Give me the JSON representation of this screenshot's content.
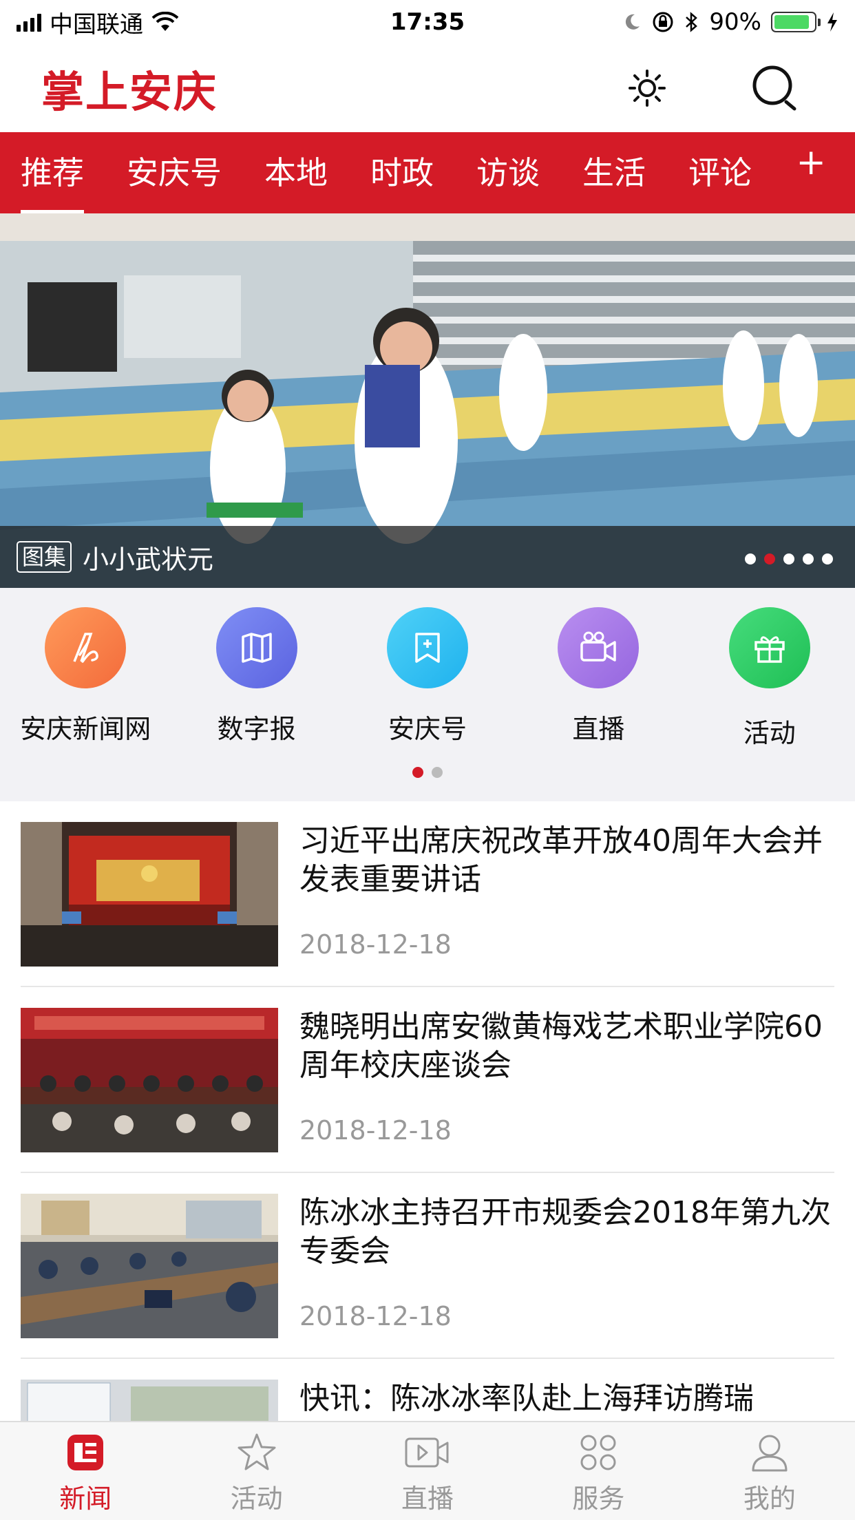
{
  "status_bar": {
    "carrier": "中国联通",
    "time": "17:35",
    "battery": "90%"
  },
  "header": {
    "logo": "掌上安庆",
    "icons": [
      "brightness-icon",
      "search-icon"
    ]
  },
  "channels": [
    "推荐",
    "安庆号",
    "本地",
    "时政",
    "访谈",
    "生活",
    "评论"
  ],
  "channel_more": "+",
  "banner": {
    "tag": "图集",
    "title": "小小武状元",
    "dots_count": 5,
    "active_dot": 2
  },
  "quick_nav": [
    {
      "label": "安庆新闻网",
      "icon": "pen-icon",
      "color_from": "#ff9a5a",
      "color_to": "#f36b3b"
    },
    {
      "label": "数字报",
      "icon": "map-book-icon",
      "color_from": "#7f8ef5",
      "color_to": "#5b63e0"
    },
    {
      "label": "安庆号",
      "icon": "bookmark-add-icon",
      "color_from": "#4fd1f7",
      "color_to": "#1fb2ee"
    },
    {
      "label": "直播",
      "icon": "video-camera-icon",
      "color_from": "#b98ef0",
      "color_to": "#9566df"
    },
    {
      "label": "活动",
      "icon": "gift-icon",
      "color_from": "#46dc7c",
      "color_to": "#1fbf55"
    }
  ],
  "news": [
    {
      "title": "习近平出席庆祝改革开放40周年大会并发表重要讲话",
      "date": "2018-12-18"
    },
    {
      "title": "魏晓明出席安徽黄梅戏艺术职业学院60周年校庆座谈会",
      "date": "2018-12-18"
    },
    {
      "title": "陈冰冰主持召开市规委会2018年第九次专委会",
      "date": "2018-12-18"
    },
    {
      "title": "快讯：陈冰冰率队赴上海拜访腾瑞",
      "date": ""
    }
  ],
  "tabs": [
    {
      "label": "新闻",
      "icon": "news-icon",
      "active": true
    },
    {
      "label": "活动",
      "icon": "star-icon",
      "active": false
    },
    {
      "label": "直播",
      "icon": "video-icon",
      "active": false
    },
    {
      "label": "服务",
      "icon": "grid-icon",
      "active": false
    },
    {
      "label": "我的",
      "icon": "user-icon",
      "active": false
    }
  ],
  "colors": {
    "brand": "#d41b27",
    "muted": "#999999"
  }
}
